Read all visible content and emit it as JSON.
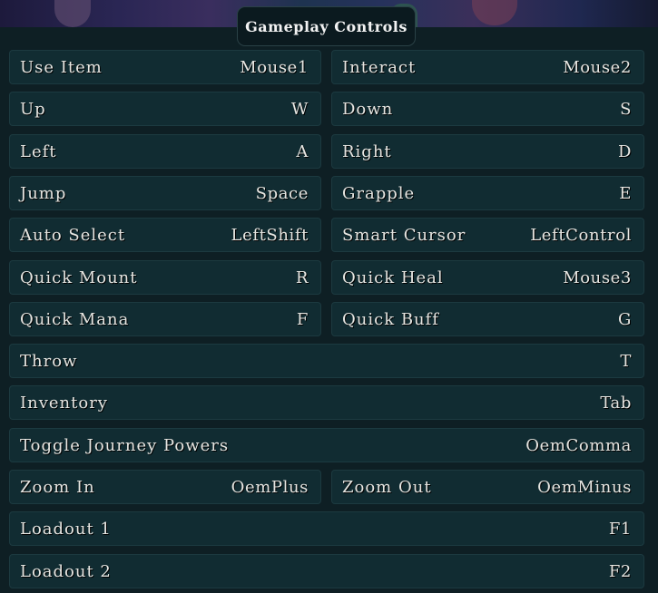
{
  "panel": {
    "title": "Gameplay Controls"
  },
  "bindings": [
    [
      {
        "label": "Use Item",
        "key": "Mouse1"
      },
      {
        "label": "Interact",
        "key": "Mouse2"
      }
    ],
    [
      {
        "label": "Up",
        "key": "W"
      },
      {
        "label": "Down",
        "key": "S"
      }
    ],
    [
      {
        "label": "Left",
        "key": "A"
      },
      {
        "label": "Right",
        "key": "D"
      }
    ],
    [
      {
        "label": "Jump",
        "key": "Space"
      },
      {
        "label": "Grapple",
        "key": "E"
      }
    ],
    [
      {
        "label": "Auto Select",
        "key": "LeftShift"
      },
      {
        "label": "Smart Cursor",
        "key": "LeftControl"
      }
    ],
    [
      {
        "label": "Quick Mount",
        "key": "R"
      },
      {
        "label": "Quick Heal",
        "key": "Mouse3"
      }
    ],
    [
      {
        "label": "Quick Mana",
        "key": "F"
      },
      {
        "label": "Quick Buff",
        "key": "G"
      }
    ],
    [
      {
        "label": "Throw",
        "key": "T"
      }
    ],
    [
      {
        "label": "Inventory",
        "key": "Tab"
      }
    ],
    [
      {
        "label": "Toggle Journey Powers",
        "key": "OemComma"
      }
    ],
    [
      {
        "label": "Zoom In",
        "key": "OemPlus"
      },
      {
        "label": "Zoom Out",
        "key": "OemMinus"
      }
    ],
    [
      {
        "label": "Loadout 1",
        "key": "F1"
      }
    ],
    [
      {
        "label": "Loadout 2",
        "key": "F2"
      }
    ]
  ]
}
